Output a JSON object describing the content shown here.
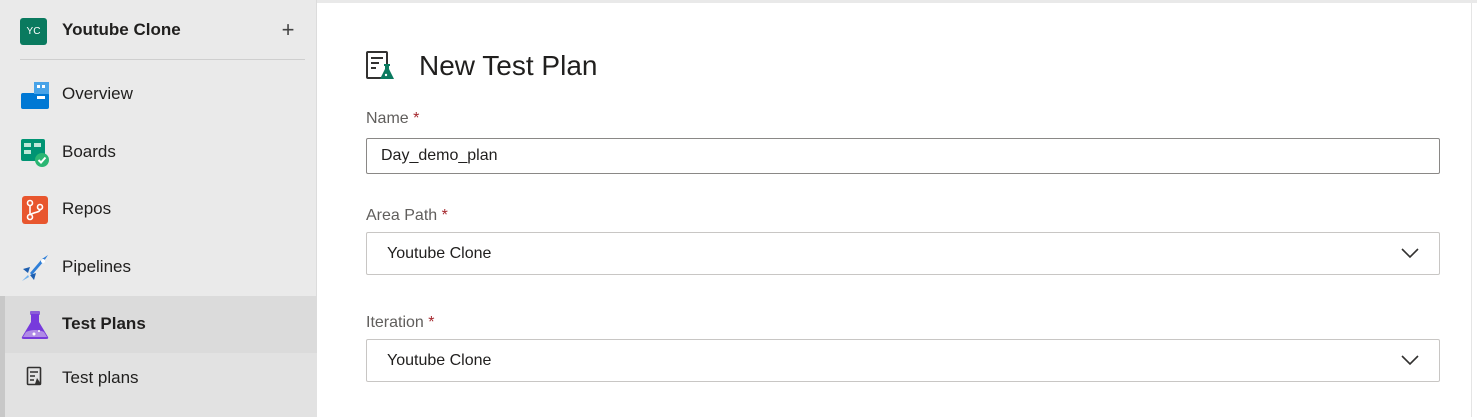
{
  "project": {
    "initials": "YC",
    "name": "Youtube Clone",
    "add_label": "+"
  },
  "nav": {
    "items": [
      {
        "label": "Overview",
        "icon": "overview-icon"
      },
      {
        "label": "Boards",
        "icon": "boards-icon"
      },
      {
        "label": "Repos",
        "icon": "repos-icon"
      },
      {
        "label": "Pipelines",
        "icon": "pipelines-icon"
      },
      {
        "label": "Test Plans",
        "icon": "test-plans-icon",
        "selected": true
      }
    ],
    "sub_items": [
      {
        "label": "Test plans",
        "icon": "test-plans-list-icon"
      }
    ]
  },
  "form": {
    "title": "New Test Plan",
    "name_label": "Name",
    "name_value": "Day_demo_plan",
    "area_path_label": "Area Path",
    "area_path_value": "Youtube Clone",
    "iteration_label": "Iteration",
    "iteration_value": "Youtube Clone",
    "required_marker": "*"
  },
  "colors": {
    "accent_green": "#0a7a5f",
    "required_red": "#a4262c",
    "boards_green": "#009473",
    "repos_orange": "#e8562e",
    "overview_blue": "#0078d4",
    "test_plans_purple": "#773adc"
  }
}
